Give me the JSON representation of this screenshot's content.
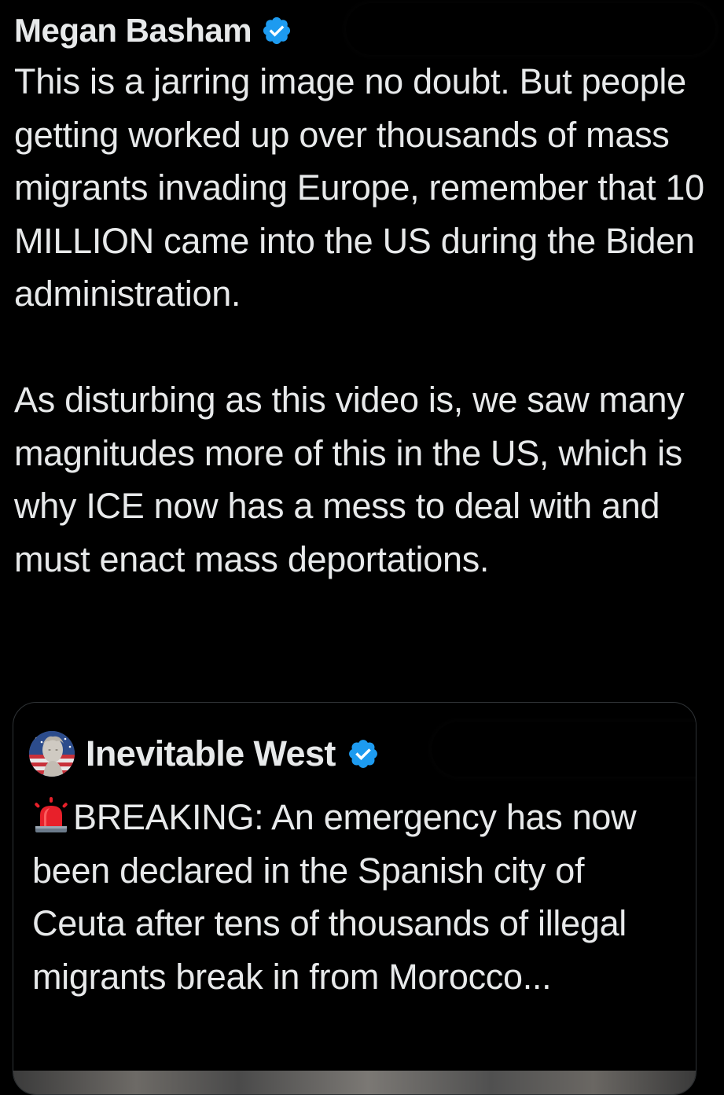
{
  "post": {
    "author": {
      "display_name": "Megan Basham",
      "verified_icon": "verified-badge-icon"
    },
    "text_paragraphs": [
      "This is a jarring image no doubt. But people getting worked up over thousands of mass migrants invading Europe, remember that 10 MILLION came into the US during the Biden administration.",
      "As disturbing as this video is, we saw many magnitudes more of this in the US, which is why ICE now has a mess to deal with and must enact mass deportations."
    ]
  },
  "quoted_post": {
    "author": {
      "display_name": "Inevitable West",
      "avatar_icon": "statue-flag-avatar",
      "verified_icon": "verified-badge-icon"
    },
    "emoji_icon": "police-siren-icon",
    "text": "BREAKING: An emergency has now been declared in the Spanish city of Ceuta after tens of thousands of illegal migrants break in from Morocco..."
  },
  "colors": {
    "background": "#000000",
    "text": "#e7e9ea",
    "verified_blue": "#1d9bf0",
    "card_border": "#2f3336"
  }
}
